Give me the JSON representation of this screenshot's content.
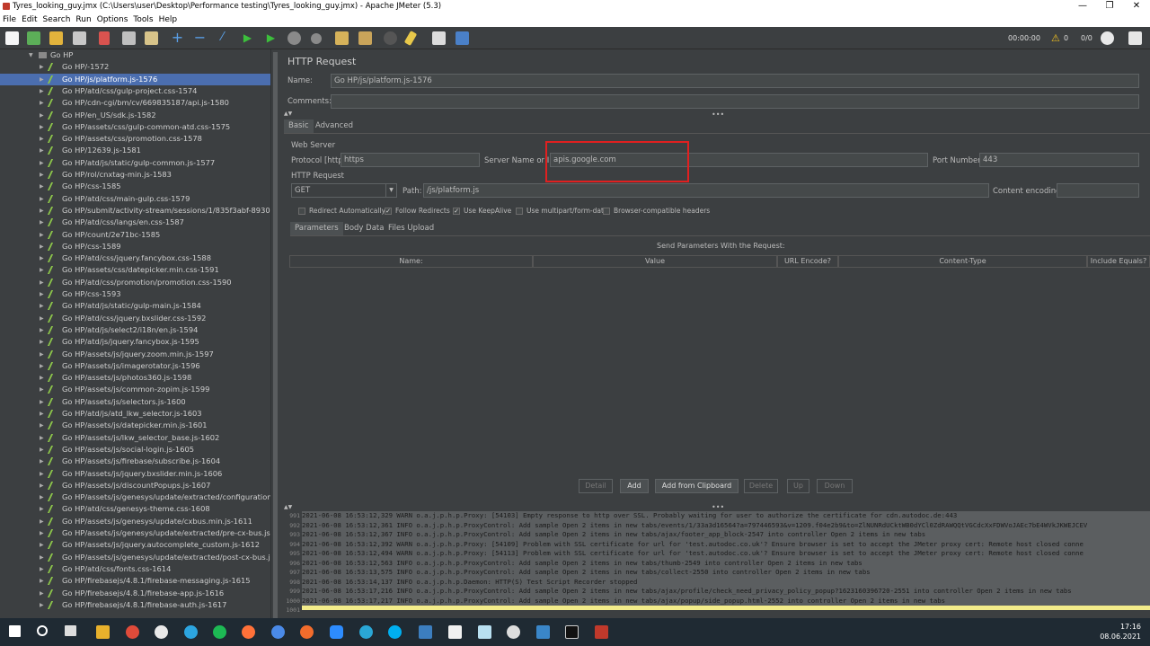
{
  "window": {
    "title": "Tyres_looking_guy.jmx (C:\\Users\\user\\Desktop\\Performance testing\\Tyres_looking_guy.jmx) - Apache JMeter (5.3)",
    "minimize": "—",
    "maximize": "❐",
    "close": "✕"
  },
  "menu": [
    "File",
    "Edit",
    "Search",
    "Run",
    "Options",
    "Tools",
    "Help"
  ],
  "toolbar": {
    "timer": "00:00:00",
    "warnings": "0",
    "threads": "0/0"
  },
  "tree": {
    "root": "Go HP",
    "items": [
      "Go HP/-1572",
      "Go HP/js/platform.js-1576",
      "Go HP/atd/css/gulp-project.css-1574",
      "Go HP/cdn-cgi/bm/cv/669835187/api.js-1580",
      "Go HP/en_US/sdk.js-1582",
      "Go HP/assets/css/gulp-common-atd.css-1575",
      "Go HP/assets/css/promotion.css-1578",
      "Go HP/12639.js-1581",
      "Go HP/atd/js/static/gulp-common.js-1577",
      "Go HP/rol/cnxtag-min.js-1583",
      "Go HP/css-1585",
      "Go HP/atd/css/main-gulp.css-1579",
      "Go HP/submit/activity-stream/sessions/1/835f3abf-8930-46b3-t",
      "Go HP/atd/css/langs/en.css-1587",
      "Go HP/count/2e71bc-1585",
      "Go HP/css-1589",
      "Go HP/atd/css/jquery.fancybox.css-1588",
      "Go HP/assets/css/datepicker.min.css-1591",
      "Go HP/atd/css/promotion/promotion.css-1590",
      "Go HP/css-1593",
      "Go HP/atd/js/static/gulp-main.js-1584",
      "Go HP/atd/css/jquery.bxslider.css-1592",
      "Go HP/atd/js/select2/i18n/en.js-1594",
      "Go HP/atd/js/jquery.fancybox.js-1595",
      "Go HP/assets/js/jquery.zoom.min.js-1597",
      "Go HP/assets/js/imagerotator.js-1596",
      "Go HP/assets/js/photos360.js-1598",
      "Go HP/assets/js/common-zopim.js-1599",
      "Go HP/assets/js/selectors.js-1600",
      "Go HP/atd/js/atd_lkw_selector.js-1603",
      "Go HP/assets/js/datepicker.min.js-1601",
      "Go HP/assets/js/lkw_selector_base.js-1602",
      "Go HP/assets/js/social-login.js-1605",
      "Go HP/assets/js/firebase/subscribe.js-1604",
      "Go HP/assets/js/jquery.bxslider.min.js-1606",
      "Go HP/assets/js/discountPopups.js-1607",
      "Go HP/assets/js/genesys/update/extracted/configuration.js-160",
      "Go HP/atd/css/genesys-theme.css-1608",
      "Go HP/assets/js/genesys/update/cxbus.min.js-1611",
      "Go HP/assets/js/genesys/update/extracted/pre-cx-bus.js-1610",
      "Go HP/assets/js/jquery.autocomplete_custom.js-1612",
      "Go HP/assets/js/genesys/update/extracted/post-cx-bus.js-1613",
      "Go HP/atd/css/fonts.css-1614",
      "Go HP/firebasejs/4.8.1/firebase-messaging.js-1615",
      "Go HP/firebasejs/4.8.1/firebase-app.js-1616",
      "Go HP/firebasejs/4.8.1/firebase-auth.js-1617"
    ]
  },
  "panel": {
    "title": "HTTP Request",
    "name_label": "Name:",
    "name_value": "Go HP/js/platform.js-1576",
    "comments_label": "Comments:",
    "tabs": [
      "Basic",
      "Advanced"
    ],
    "web_server": "Web Server",
    "protocol_label": "Protocol [http]:",
    "protocol_value": "https",
    "server_label": "Server Name or IP:",
    "server_value": "apis.google.com",
    "port_label": "Port Number:",
    "port_value": "443",
    "http_request": "HTTP Request",
    "method": "GET",
    "path_label": "Path:",
    "path_value": "/js/platform.js",
    "encoding_label": "Content encoding:",
    "checkboxes": [
      {
        "label": "Redirect Automatically",
        "checked": false
      },
      {
        "label": "Follow Redirects",
        "checked": true
      },
      {
        "label": "Use KeepAlive",
        "checked": true
      },
      {
        "label": "Use multipart/form-data",
        "checked": false
      },
      {
        "label": "Browser-compatible headers",
        "checked": false
      }
    ],
    "subtabs": [
      "Parameters",
      "Body Data",
      "Files Upload"
    ],
    "params_title": "Send Parameters With the Request:",
    "columns": [
      "Name:",
      "Value",
      "URL Encode?",
      "Content-Type",
      "Include Equals?"
    ],
    "buttons": [
      "Detail",
      "Add",
      "Add from Clipboard",
      "Delete",
      "Up",
      "Down"
    ]
  },
  "log": {
    "lines": [
      {
        "n": "991",
        "t": "2021-06-08 16:53:12,329 WARN o.a.j.p.h.p.Proxy: [54103] Empty response to http over SSL. Probably waiting for user to authorize the certificate for cdn.autodoc.de:443"
      },
      {
        "n": "992",
        "t": "2021-06-08 16:53:12,361 INFO o.a.j.p.h.p.ProxyControl: Add sample Open 2 items in new tabs/events/1/33a3d16564?a=797446593&v=1209.f04e2b9&to=ZlNUNRdUCktWB0dYCl0ZdRAWQQtVGCdcXxFDWVoJAEc7bE4WVkJKWEJCEV"
      },
      {
        "n": "993",
        "t": "2021-06-08 16:53:12,367 INFO o.a.j.p.h.p.ProxyControl: Add sample Open 2 items in new tabs/ajax/footer_app_block-2547 into controller Open 2 items in new tabs"
      },
      {
        "n": "994",
        "t": "2021-06-08 16:53:12,392 WARN o.a.j.p.h.p.Proxy: [54109] Problem with SSL certificate for url for 'test.autodoc.co.uk'? Ensure browser is set to accept the JMeter proxy cert: Remote host closed conne"
      },
      {
        "n": "995",
        "t": "2021-06-08 16:53:12,494 WARN o.a.j.p.h.p.Proxy: [54113] Problem with SSL certificate for url for 'test.autodoc.co.uk'? Ensure browser is set to accept the JMeter proxy cert: Remote host closed conne"
      },
      {
        "n": "996",
        "t": "2021-06-08 16:53:12,563 INFO o.a.j.p.h.p.ProxyControl: Add sample Open 2 items in new tabs/thumb-2549 into controller Open 2 items in new tabs"
      },
      {
        "n": "997",
        "t": "2021-06-08 16:53:13,575 INFO o.a.j.p.h.p.ProxyControl: Add sample Open 2 items in new tabs/collect-2550 into controller Open 2 items in new tabs"
      },
      {
        "n": "998",
        "t": "2021-06-08 16:53:14,137 INFO o.a.j.p.h.p.Daemon: HTTP(S) Test Script Recorder stopped"
      },
      {
        "n": "999",
        "t": "2021-06-08 16:53:17,216 INFO o.a.j.p.h.p.ProxyControl: Add sample Open 2 items in new tabs/ajax/profile/check_need_privacy_policy_popup?1623160396720-2551 into controller Open 2 items in new tabs"
      },
      {
        "n": "1000",
        "t": "2021-06-08 16:53:17,217 INFO o.a.j.p.h.p.ProxyControl: Add sample Open 2 items in new tabs/ajax/popup/side_popup.html-2552 into controller Open 2 items in new tabs"
      },
      {
        "n": "1001",
        "t": ""
      }
    ]
  },
  "taskbar": {
    "time": "17:16",
    "date": "08.06.2021"
  },
  "colors": {
    "selection": "#4b6eaf",
    "highlight_box": "#e02020",
    "log_highlight": "#f3ec8a"
  }
}
